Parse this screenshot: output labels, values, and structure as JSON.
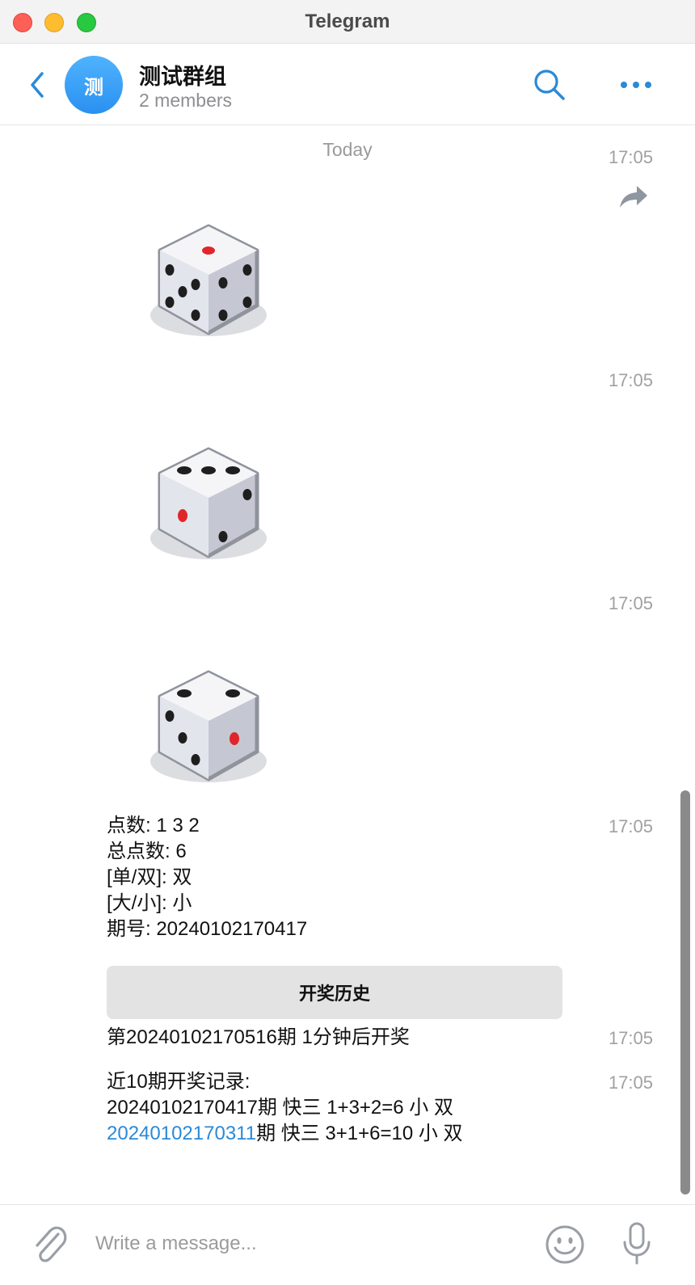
{
  "window": {
    "title": "Telegram"
  },
  "header": {
    "avatar_letter": "测",
    "chat_name": "测试群组",
    "members": "2 members",
    "back_icon": "chevron-left-icon",
    "search_icon": "search-icon",
    "more_icon": "more-horizontal-icon"
  },
  "messages": {
    "date_separator": "Today",
    "dice": [
      {
        "time": "17:05",
        "value": 5
      },
      {
        "time": "17:05",
        "value": 3
      },
      {
        "time": "17:05",
        "value": 2
      }
    ],
    "result": {
      "time": "17:05",
      "lines": [
        "点数: 1 3 2",
        "总点数: 6",
        "[单/双]: 双",
        "[大/小]: 小",
        "期号: 20240102170417"
      ],
      "button_label": "开奖历史"
    },
    "next_draw": {
      "time": "17:05",
      "text": "第20240102170516期 1分钟后开奖"
    },
    "history": {
      "time": "17:05",
      "heading": "近10期开奖记录:",
      "row1": "20240102170417期 快三 1+3+2=6 小 双",
      "row2_link": "20240102170311",
      "row2_rest": "期 快三 3+1+6=10 小 双"
    }
  },
  "composer": {
    "placeholder": "Write a message...",
    "attach_icon": "paperclip-icon",
    "emoji_icon": "smile-icon",
    "mic_icon": "microphone-icon"
  },
  "colors": {
    "accent": "#2a8ad8",
    "avatar_top": "#4fb3ff",
    "avatar_bottom": "#2a90f0",
    "dice_pip": "#1e1e1e",
    "dice_red_pip": "#e0262a"
  }
}
